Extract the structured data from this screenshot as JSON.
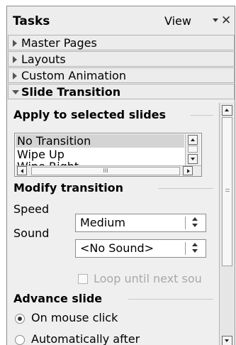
{
  "panel": {
    "title": "Tasks",
    "view_label": "View",
    "close_glyph": "✕"
  },
  "sections": [
    {
      "label": "Master Pages",
      "expanded": false
    },
    {
      "label": "Layouts",
      "expanded": false
    },
    {
      "label": "Custom Animation",
      "expanded": false
    },
    {
      "label": "Slide Transition",
      "expanded": true
    }
  ],
  "apply": {
    "title": "Apply to selected slides",
    "items": [
      "No Transition",
      "Wipe Up",
      "Wipe Right"
    ],
    "selected": "No Transition",
    "hthumb_glyph": "III"
  },
  "modify": {
    "title": "Modify transition",
    "speed_label": "Speed",
    "speed_value": "Medium",
    "sound_label": "Sound",
    "sound_value": "<No Sound>",
    "loop_label": "Loop until next sou",
    "loop_checked": false
  },
  "advance": {
    "title": "Advance slide",
    "on_click_label": "On mouse click",
    "auto_label": "Automatically after",
    "selected": "On mouse click"
  },
  "colors": {
    "panel_bg": "#efefef",
    "selection": "#d4d4d4",
    "disabled_text": "#a8a8a8"
  },
  "icons": {
    "close": "close-icon",
    "view_menu": "chevron-down-icon",
    "collapsed": "triangle-right-icon",
    "expanded": "triangle-down-icon"
  }
}
